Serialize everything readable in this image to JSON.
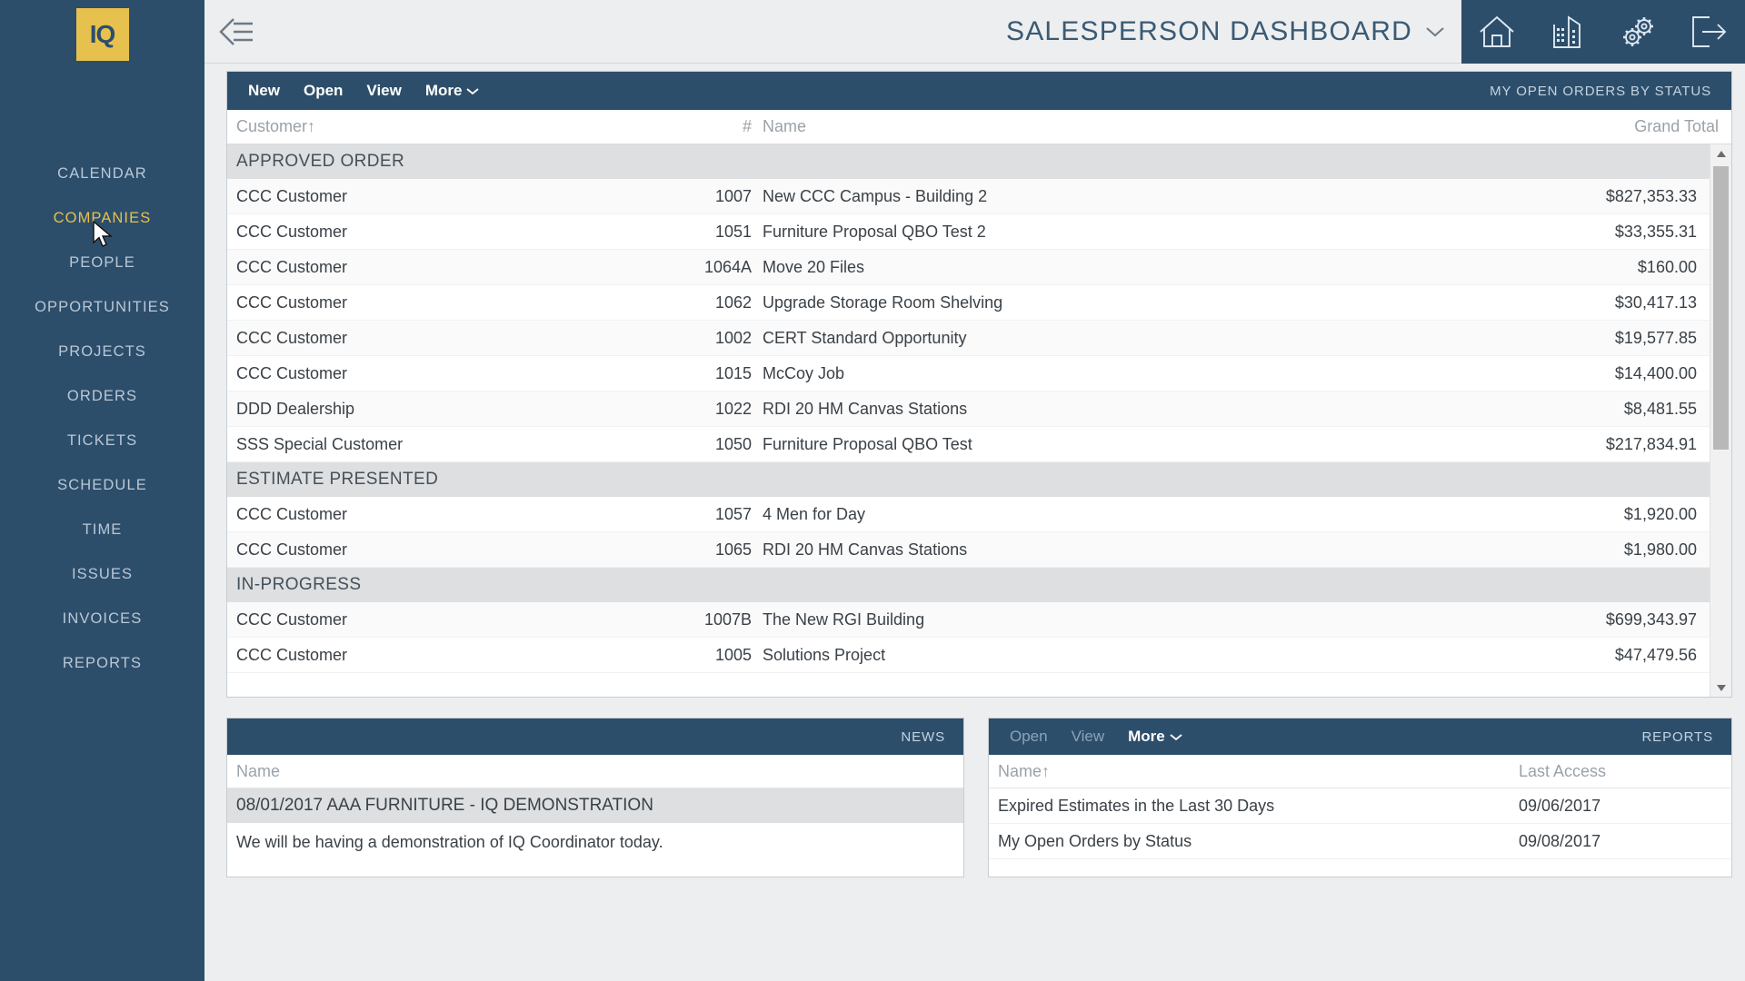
{
  "sidebar": {
    "logo_text": "IQ",
    "items": [
      {
        "label": "CALENDAR",
        "active": false
      },
      {
        "label": "COMPANIES",
        "active": true
      },
      {
        "label": "PEOPLE",
        "active": false
      },
      {
        "label": "OPPORTUNITIES",
        "active": false
      },
      {
        "label": "PROJECTS",
        "active": false
      },
      {
        "label": "ORDERS",
        "active": false
      },
      {
        "label": "TICKETS",
        "active": false
      },
      {
        "label": "SCHEDULE",
        "active": false
      },
      {
        "label": "TIME",
        "active": false
      },
      {
        "label": "ISSUES",
        "active": false
      },
      {
        "label": "INVOICES",
        "active": false
      },
      {
        "label": "REPORTS",
        "active": false
      }
    ]
  },
  "header": {
    "back_icon": "back-menu-icon",
    "title": "SALESPERSON DASHBOARD",
    "title_chevron": "chevron-down-icon",
    "icons": [
      {
        "name": "home-icon"
      },
      {
        "name": "building-icon"
      },
      {
        "name": "gears-settings-icon"
      },
      {
        "name": "logout-icon"
      }
    ]
  },
  "grid": {
    "toolbar": {
      "new_label": "New",
      "open_label": "Open",
      "view_label": "View",
      "more_label": "More"
    },
    "title": "MY OPEN ORDERS BY STATUS",
    "columns": {
      "customer": "Customer↑",
      "number": "#",
      "name": "Name",
      "grand_total": "Grand Total"
    },
    "groups": [
      {
        "label": "APPROVED ORDER",
        "rows": [
          {
            "customer": "CCC Customer",
            "number": "1007",
            "name": "New CCC Campus - Building 2",
            "total": "$827,353.33"
          },
          {
            "customer": "CCC Customer",
            "number": "1051",
            "name": "Furniture Proposal QBO Test 2",
            "total": "$33,355.31"
          },
          {
            "customer": "CCC Customer",
            "number": "1064A",
            "name": "Move 20 Files",
            "total": "$160.00"
          },
          {
            "customer": "CCC Customer",
            "number": "1062",
            "name": "Upgrade Storage Room Shelving",
            "total": "$30,417.13"
          },
          {
            "customer": "CCC Customer",
            "number": "1002",
            "name": "CERT Standard Opportunity",
            "total": "$19,577.85"
          },
          {
            "customer": "CCC Customer",
            "number": "1015",
            "name": "McCoy Job",
            "total": "$14,400.00"
          },
          {
            "customer": "DDD Dealership",
            "number": "1022",
            "name": "RDI 20 HM Canvas Stations",
            "total": "$8,481.55"
          },
          {
            "customer": "SSS Special Customer",
            "number": "1050",
            "name": "Furniture Proposal QBO Test",
            "total": "$217,834.91"
          }
        ]
      },
      {
        "label": "ESTIMATE PRESENTED",
        "rows": [
          {
            "customer": "CCC Customer",
            "number": "1057",
            "name": "4 Men for Day",
            "total": "$1,920.00"
          },
          {
            "customer": "CCC Customer",
            "number": "1065",
            "name": "RDI 20 HM Canvas Stations",
            "total": "$1,980.00"
          }
        ]
      },
      {
        "label": "IN-PROGRESS",
        "rows": [
          {
            "customer": "CCC Customer",
            "number": "1007B",
            "name": "The New RGI Building",
            "total": "$699,343.97"
          },
          {
            "customer": "CCC Customer",
            "number": "1005",
            "name": "Solutions Project",
            "total": "$47,479.56"
          }
        ]
      }
    ]
  },
  "news": {
    "title": "NEWS",
    "column_name": "Name",
    "headline": "08/01/2017 AAA FURNITURE - IQ DEMONSTRATION",
    "body": "We will be having a demonstration of IQ Coordinator today."
  },
  "reports": {
    "title": "REPORTS",
    "toolbar": {
      "open_label": "Open",
      "view_label": "View",
      "more_label": "More"
    },
    "columns": {
      "name": "Name↑",
      "last_access": "Last Access"
    },
    "rows": [
      {
        "name": "Expired Estimates in the Last 30 Days",
        "last_access": "09/06/2017"
      },
      {
        "name": "My Open Orders by Status",
        "last_access": "09/08/2017"
      }
    ]
  },
  "colors": {
    "sidebar_bg": "#2d4e6b",
    "accent_gold": "#e7c14e",
    "header_title": "#3b5a73",
    "group_row_bg": "#dddfe1"
  }
}
